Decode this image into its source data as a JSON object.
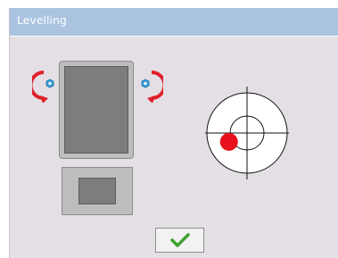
{
  "window": {
    "title": "Levelling"
  },
  "icons": {
    "rotate_left": "rotate-counterclockwise-icon",
    "rotate_right": "rotate-clockwise-icon",
    "screw_left": "adjustment-screw-icon",
    "screw_right": "adjustment-screw-icon",
    "confirm": "checkmark-icon"
  },
  "colors": {
    "title_bar": "#a9c3e0",
    "background": "#e3dfe4",
    "rotate_arrow": "#e0202a",
    "screw": "#3aa0e0",
    "bubble": "#e8101c",
    "check": "#3fa12f"
  },
  "level_indicator": {
    "bubble_offset": {
      "x": -0.45,
      "y": -0.22
    }
  }
}
